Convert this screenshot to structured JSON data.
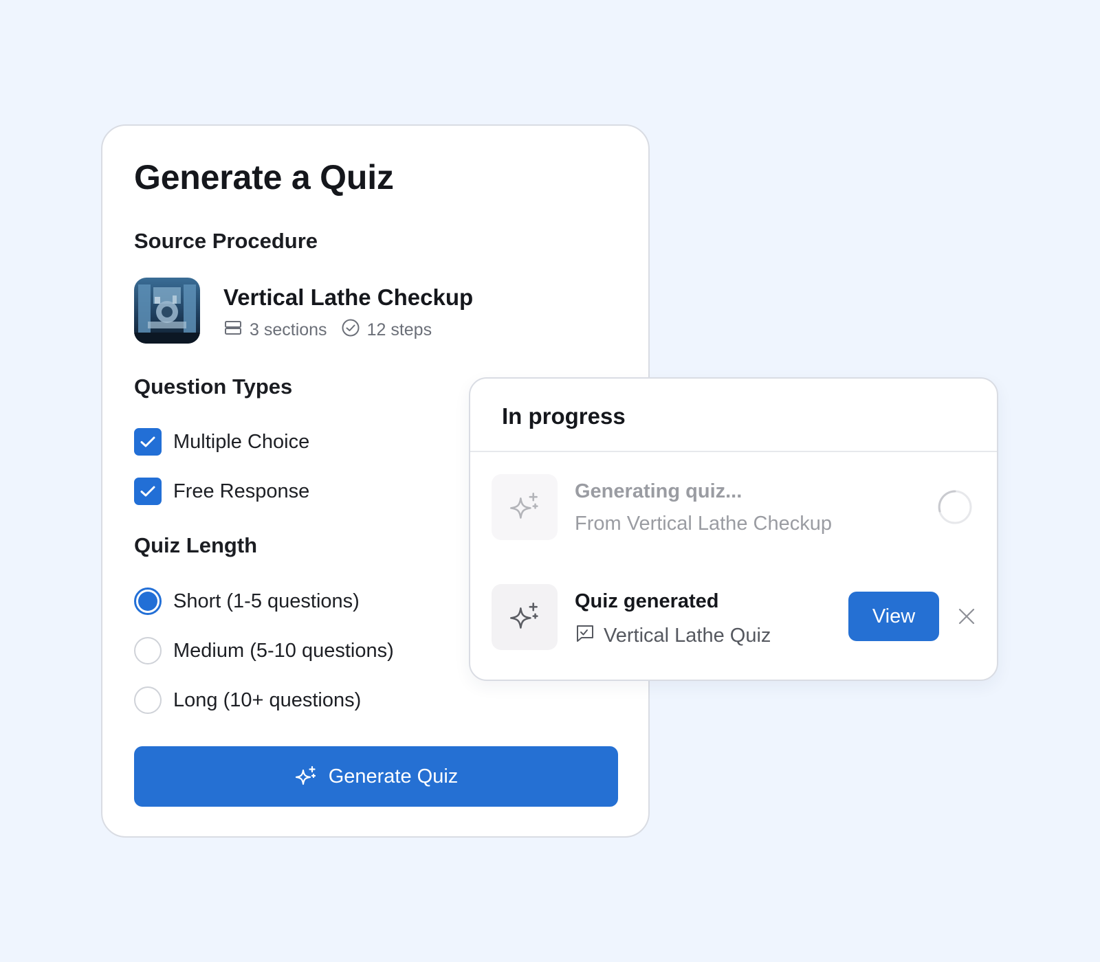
{
  "quiz_form": {
    "title": "Generate a Quiz",
    "source_heading": "Source Procedure",
    "procedure": {
      "name": "Vertical Lathe Checkup",
      "sections": "3 sections",
      "steps": "12 steps"
    },
    "question_types_heading": "Question Types",
    "question_types": [
      {
        "label": "Multiple Choice",
        "checked": true
      },
      {
        "label": "Free Response",
        "checked": true
      }
    ],
    "length_heading": "Quiz Length",
    "lengths": [
      {
        "label": "Short (1-5 questions)",
        "selected": true
      },
      {
        "label": "Medium (5-10 questions)",
        "selected": false
      },
      {
        "label": "Long (10+ questions)",
        "selected": false
      }
    ],
    "generate_label": "Generate Quiz"
  },
  "progress_panel": {
    "title": "In progress",
    "tasks": [
      {
        "title": "Generating quiz...",
        "subtitle": "From Vertical Lathe Checkup",
        "status": "loading"
      },
      {
        "title": "Quiz generated",
        "subtitle": "Vertical Lathe Quiz",
        "status": "done",
        "action_label": "View"
      }
    ]
  },
  "colors": {
    "background": "#eff5fe",
    "accent": "#2570d3",
    "card": "#ffffff",
    "muted_text": "#9a9ca2"
  },
  "icons": [
    "sections-icon",
    "check-circle-icon",
    "checkmark-icon",
    "sparkle-icon",
    "spinner-icon",
    "quiz-doc-icon",
    "close-icon"
  ]
}
